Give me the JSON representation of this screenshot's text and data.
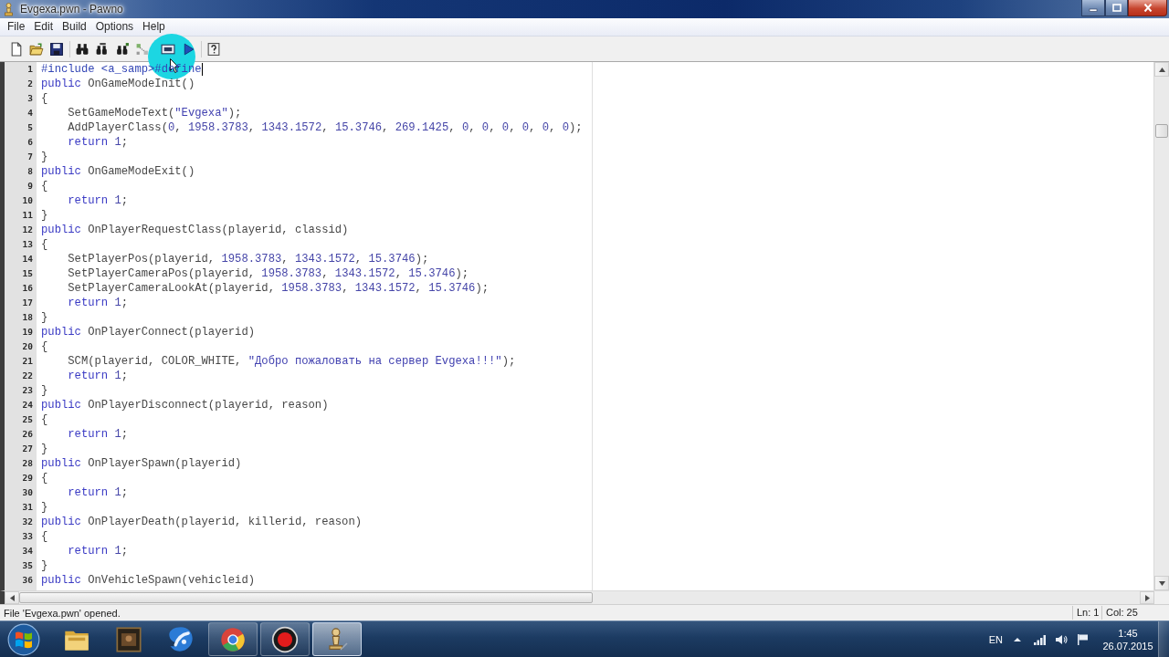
{
  "window": {
    "title": "Evgexa.pwn - Pawno"
  },
  "menu": [
    "File",
    "Edit",
    "Build",
    "Options",
    "Help"
  ],
  "editor": {
    "lines": [
      {
        "number": "1",
        "caret": true,
        "tokens": [
          {
            "kind": "preprocessor",
            "text": "#include <a_samp>#define"
          }
        ]
      },
      {
        "number": "2",
        "caret": false,
        "tokens": [
          {
            "kind": "keyword",
            "text": "public"
          },
          {
            "kind": "plain",
            "text": " OnGameModeInit()"
          }
        ]
      },
      {
        "number": "3",
        "caret": false,
        "tokens": [
          {
            "kind": "plain",
            "text": "{"
          }
        ]
      },
      {
        "number": "4",
        "caret": false,
        "tokens": [
          {
            "kind": "plain",
            "text": "    SetGameModeText("
          },
          {
            "kind": "string",
            "text": "\"Evgexa\""
          },
          {
            "kind": "plain",
            "text": ");"
          }
        ]
      },
      {
        "number": "5",
        "caret": false,
        "tokens": [
          {
            "kind": "plain",
            "text": "    AddPlayerClass("
          },
          {
            "kind": "number",
            "text": "0"
          },
          {
            "kind": "plain",
            "text": ", "
          },
          {
            "kind": "number",
            "text": "1958.3783"
          },
          {
            "kind": "plain",
            "text": ", "
          },
          {
            "kind": "number",
            "text": "1343.1572"
          },
          {
            "kind": "plain",
            "text": ", "
          },
          {
            "kind": "number",
            "text": "15.3746"
          },
          {
            "kind": "plain",
            "text": ", "
          },
          {
            "kind": "number",
            "text": "269.1425"
          },
          {
            "kind": "plain",
            "text": ", "
          },
          {
            "kind": "number",
            "text": "0"
          },
          {
            "kind": "plain",
            "text": ", "
          },
          {
            "kind": "number",
            "text": "0"
          },
          {
            "kind": "plain",
            "text": ", "
          },
          {
            "kind": "number",
            "text": "0"
          },
          {
            "kind": "plain",
            "text": ", "
          },
          {
            "kind": "number",
            "text": "0"
          },
          {
            "kind": "plain",
            "text": ", "
          },
          {
            "kind": "number",
            "text": "0"
          },
          {
            "kind": "plain",
            "text": ", "
          },
          {
            "kind": "number",
            "text": "0"
          },
          {
            "kind": "plain",
            "text": ");"
          }
        ]
      },
      {
        "number": "6",
        "caret": false,
        "tokens": [
          {
            "kind": "keyword",
            "text": "    return "
          },
          {
            "kind": "number",
            "text": "1"
          },
          {
            "kind": "plain",
            "text": ";"
          }
        ]
      },
      {
        "number": "7",
        "caret": false,
        "tokens": [
          {
            "kind": "plain",
            "text": "}"
          }
        ]
      },
      {
        "number": "8",
        "caret": false,
        "tokens": [
          {
            "kind": "keyword",
            "text": "public"
          },
          {
            "kind": "plain",
            "text": " OnGameModeExit()"
          }
        ]
      },
      {
        "number": "9",
        "caret": false,
        "tokens": [
          {
            "kind": "plain",
            "text": "{"
          }
        ]
      },
      {
        "number": "10",
        "caret": false,
        "tokens": [
          {
            "kind": "keyword",
            "text": "    return "
          },
          {
            "kind": "number",
            "text": "1"
          },
          {
            "kind": "plain",
            "text": ";"
          }
        ]
      },
      {
        "number": "11",
        "caret": false,
        "tokens": [
          {
            "kind": "plain",
            "text": "}"
          }
        ]
      },
      {
        "number": "12",
        "caret": false,
        "tokens": [
          {
            "kind": "keyword",
            "text": "public"
          },
          {
            "kind": "plain",
            "text": " OnPlayerRequestClass(playerid, classid)"
          }
        ]
      },
      {
        "number": "13",
        "caret": false,
        "tokens": [
          {
            "kind": "plain",
            "text": "{"
          }
        ]
      },
      {
        "number": "14",
        "caret": false,
        "tokens": [
          {
            "kind": "plain",
            "text": "    SetPlayerPos(playerid, "
          },
          {
            "kind": "number",
            "text": "1958.3783"
          },
          {
            "kind": "plain",
            "text": ", "
          },
          {
            "kind": "number",
            "text": "1343.1572"
          },
          {
            "kind": "plain",
            "text": ", "
          },
          {
            "kind": "number",
            "text": "15.3746"
          },
          {
            "kind": "plain",
            "text": ");"
          }
        ]
      },
      {
        "number": "15",
        "caret": false,
        "tokens": [
          {
            "kind": "plain",
            "text": "    SetPlayerCameraPos(playerid, "
          },
          {
            "kind": "number",
            "text": "1958.3783"
          },
          {
            "kind": "plain",
            "text": ", "
          },
          {
            "kind": "number",
            "text": "1343.1572"
          },
          {
            "kind": "plain",
            "text": ", "
          },
          {
            "kind": "number",
            "text": "15.3746"
          },
          {
            "kind": "plain",
            "text": ");"
          }
        ]
      },
      {
        "number": "16",
        "caret": false,
        "tokens": [
          {
            "kind": "plain",
            "text": "    SetPlayerCameraLookAt(playerid, "
          },
          {
            "kind": "number",
            "text": "1958.3783"
          },
          {
            "kind": "plain",
            "text": ", "
          },
          {
            "kind": "number",
            "text": "1343.1572"
          },
          {
            "kind": "plain",
            "text": ", "
          },
          {
            "kind": "number",
            "text": "15.3746"
          },
          {
            "kind": "plain",
            "text": ");"
          }
        ]
      },
      {
        "number": "17",
        "caret": false,
        "tokens": [
          {
            "kind": "keyword",
            "text": "    return "
          },
          {
            "kind": "number",
            "text": "1"
          },
          {
            "kind": "plain",
            "text": ";"
          }
        ]
      },
      {
        "number": "18",
        "caret": false,
        "tokens": [
          {
            "kind": "plain",
            "text": "}"
          }
        ]
      },
      {
        "number": "19",
        "caret": false,
        "tokens": [
          {
            "kind": "keyword",
            "text": "public"
          },
          {
            "kind": "plain",
            "text": " OnPlayerConnect(playerid)"
          }
        ]
      },
      {
        "number": "20",
        "caret": false,
        "tokens": [
          {
            "kind": "plain",
            "text": "{"
          }
        ]
      },
      {
        "number": "21",
        "caret": false,
        "tokens": [
          {
            "kind": "plain",
            "text": "    SCM(playerid, COLOR_WHITE, "
          },
          {
            "kind": "string",
            "text": "\"Добро пожаловать на сервер Evgexa!!!\""
          },
          {
            "kind": "plain",
            "text": ");"
          }
        ]
      },
      {
        "number": "22",
        "caret": false,
        "tokens": [
          {
            "kind": "keyword",
            "text": "    return "
          },
          {
            "kind": "number",
            "text": "1"
          },
          {
            "kind": "plain",
            "text": ";"
          }
        ]
      },
      {
        "number": "23",
        "caret": false,
        "tokens": [
          {
            "kind": "plain",
            "text": "}"
          }
        ]
      },
      {
        "number": "24",
        "caret": false,
        "tokens": [
          {
            "kind": "keyword",
            "text": "public"
          },
          {
            "kind": "plain",
            "text": " OnPlayerDisconnect(playerid, reason)"
          }
        ]
      },
      {
        "number": "25",
        "caret": false,
        "tokens": [
          {
            "kind": "plain",
            "text": "{"
          }
        ]
      },
      {
        "number": "26",
        "caret": false,
        "tokens": [
          {
            "kind": "keyword",
            "text": "    return "
          },
          {
            "kind": "number",
            "text": "1"
          },
          {
            "kind": "plain",
            "text": ";"
          }
        ]
      },
      {
        "number": "27",
        "caret": false,
        "tokens": [
          {
            "kind": "plain",
            "text": "}"
          }
        ]
      },
      {
        "number": "28",
        "caret": false,
        "tokens": [
          {
            "kind": "keyword",
            "text": "public"
          },
          {
            "kind": "plain",
            "text": " OnPlayerSpawn(playerid)"
          }
        ]
      },
      {
        "number": "29",
        "caret": false,
        "tokens": [
          {
            "kind": "plain",
            "text": "{"
          }
        ]
      },
      {
        "number": "30",
        "caret": false,
        "tokens": [
          {
            "kind": "keyword",
            "text": "    return "
          },
          {
            "kind": "number",
            "text": "1"
          },
          {
            "kind": "plain",
            "text": ";"
          }
        ]
      },
      {
        "number": "31",
        "caret": false,
        "tokens": [
          {
            "kind": "plain",
            "text": "}"
          }
        ]
      },
      {
        "number": "32",
        "caret": false,
        "tokens": [
          {
            "kind": "keyword",
            "text": "public"
          },
          {
            "kind": "plain",
            "text": " OnPlayerDeath(playerid, killerid, reason)"
          }
        ]
      },
      {
        "number": "33",
        "caret": false,
        "tokens": [
          {
            "kind": "plain",
            "text": "{"
          }
        ]
      },
      {
        "number": "34",
        "caret": false,
        "tokens": [
          {
            "kind": "keyword",
            "text": "    return "
          },
          {
            "kind": "number",
            "text": "1"
          },
          {
            "kind": "plain",
            "text": ";"
          }
        ]
      },
      {
        "number": "35",
        "caret": false,
        "tokens": [
          {
            "kind": "plain",
            "text": "}"
          }
        ]
      },
      {
        "number": "36",
        "caret": false,
        "tokens": [
          {
            "kind": "keyword",
            "text": "public"
          },
          {
            "kind": "plain",
            "text": " OnVehicleSpawn(vehicleid)"
          }
        ]
      }
    ]
  },
  "status_bar": {
    "message": "File 'Evgexa.pwn' opened.",
    "line": "Ln: 1",
    "column": "Col: 25"
  },
  "taskbar": {
    "apps": [
      {
        "kind": "folder",
        "running": false,
        "selected": false
      },
      {
        "kind": "picture",
        "running": false,
        "selected": false
      },
      {
        "kind": "round",
        "running": false,
        "selected": false
      },
      {
        "kind": "ring",
        "running": true,
        "selected": false
      },
      {
        "kind": "record",
        "running": true,
        "selected": false
      },
      {
        "kind": "pawn",
        "running": true,
        "selected": true
      }
    ],
    "tray": {
      "language": "EN",
      "time": "1:45",
      "date": "26.07.2015"
    }
  }
}
